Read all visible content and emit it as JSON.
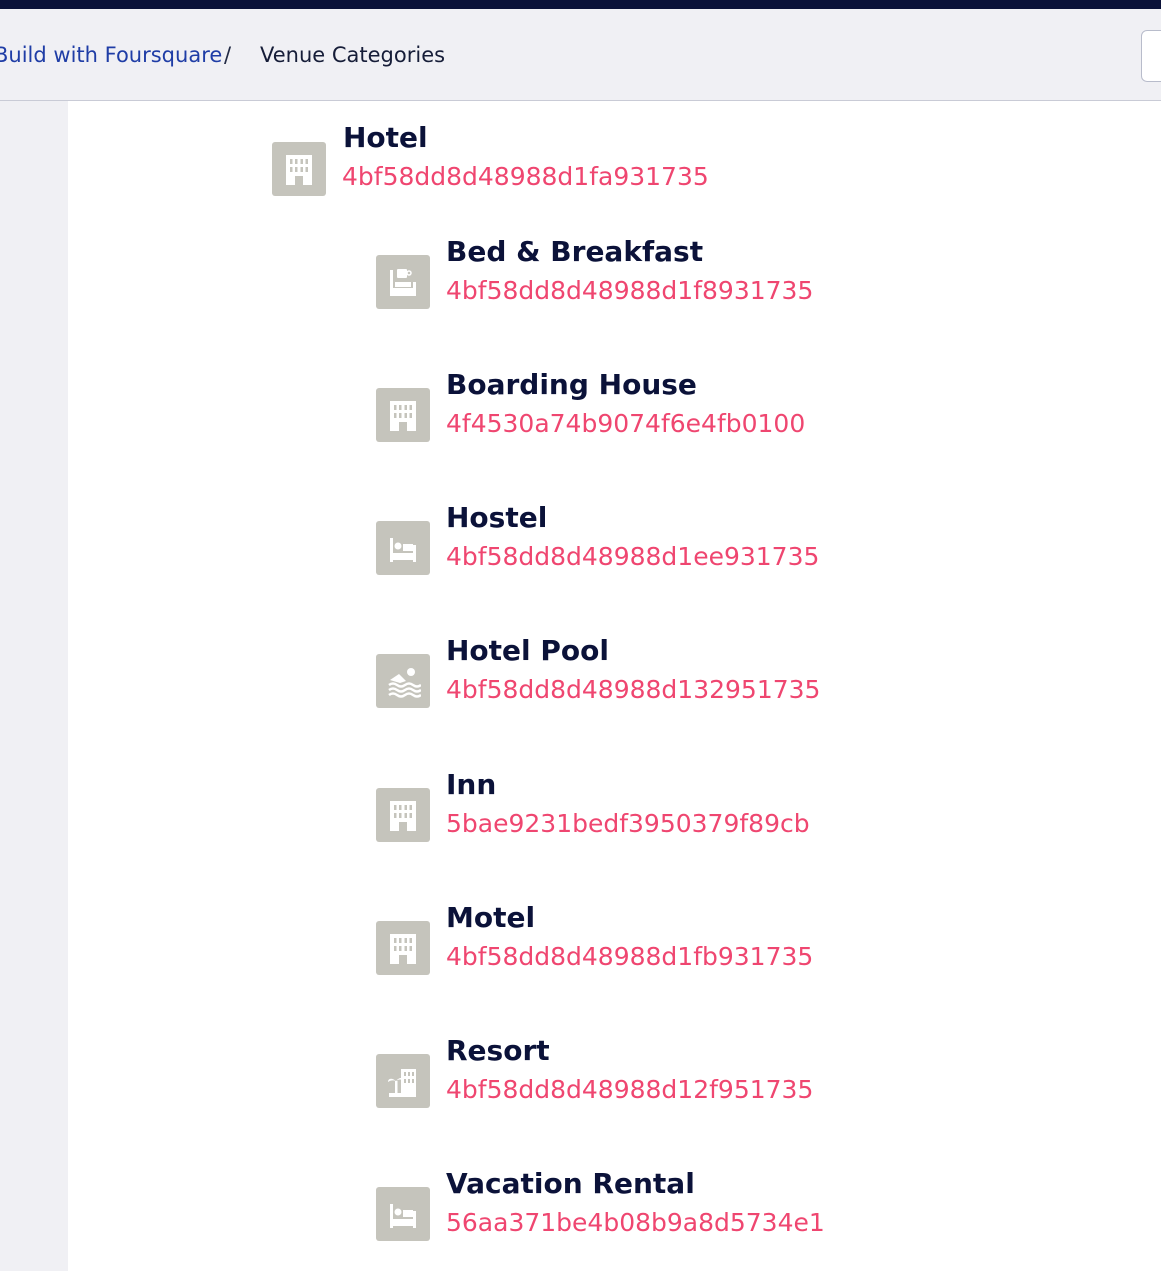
{
  "breadcrumb": {
    "link_label": "Build with Foursquare",
    "separator": "/",
    "current": "Venue Categories"
  },
  "colors": {
    "nav_dark": "#0b1239",
    "link": "#1f3da6",
    "id_pink": "#ef4670",
    "icon_bg": "#c5c4bc"
  },
  "parent": {
    "name": "Hotel",
    "id": "4bf58dd8d48988d1fa931735",
    "icon": "building-icon"
  },
  "children": [
    {
      "name": "Bed & Breakfast",
      "id": "4bf58dd8d48988d1f8931735",
      "icon": "bed-breakfast-icon"
    },
    {
      "name": "Boarding House",
      "id": "4f4530a74b9074f6e4fb0100",
      "icon": "building-icon"
    },
    {
      "name": "Hostel",
      "id": "4bf58dd8d48988d1ee931735",
      "icon": "bed-icon"
    },
    {
      "name": "Hotel Pool",
      "id": "4bf58dd8d48988d132951735",
      "icon": "pool-icon"
    },
    {
      "name": "Inn",
      "id": "5bae9231bedf3950379f89cb",
      "icon": "building-icon"
    },
    {
      "name": "Motel",
      "id": "4bf58dd8d48988d1fb931735",
      "icon": "building-icon"
    },
    {
      "name": "Resort",
      "id": "4bf58dd8d48988d12f951735",
      "icon": "resort-icon"
    },
    {
      "name": "Vacation Rental",
      "id": "56aa371be4b08b9a8d5734e1",
      "icon": "bed-icon"
    }
  ]
}
